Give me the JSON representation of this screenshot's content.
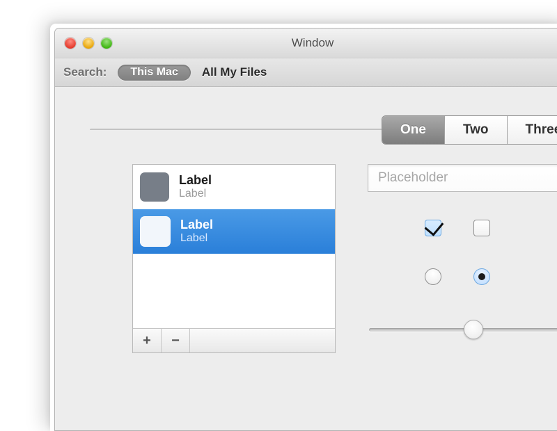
{
  "window": {
    "title": "Window"
  },
  "scope": {
    "label": "Search:",
    "selected": "This Mac",
    "other": "All My Files"
  },
  "tabs": [
    {
      "label": "One",
      "selected": true
    },
    {
      "label": "Two",
      "selected": false
    },
    {
      "label": "Three",
      "selected": false
    }
  ],
  "list": {
    "rows": [
      {
        "primary": "Label",
        "secondary": "Label",
        "selected": false
      },
      {
        "primary": "Label",
        "secondary": "Label",
        "selected": true
      }
    ],
    "add": "+",
    "remove": "−"
  },
  "field": {
    "placeholder": "Placeholder",
    "value": ""
  },
  "checks": [
    true,
    false
  ],
  "radios": [
    false,
    true
  ],
  "slider": {
    "min": 0,
    "max": 100,
    "value": 50
  }
}
